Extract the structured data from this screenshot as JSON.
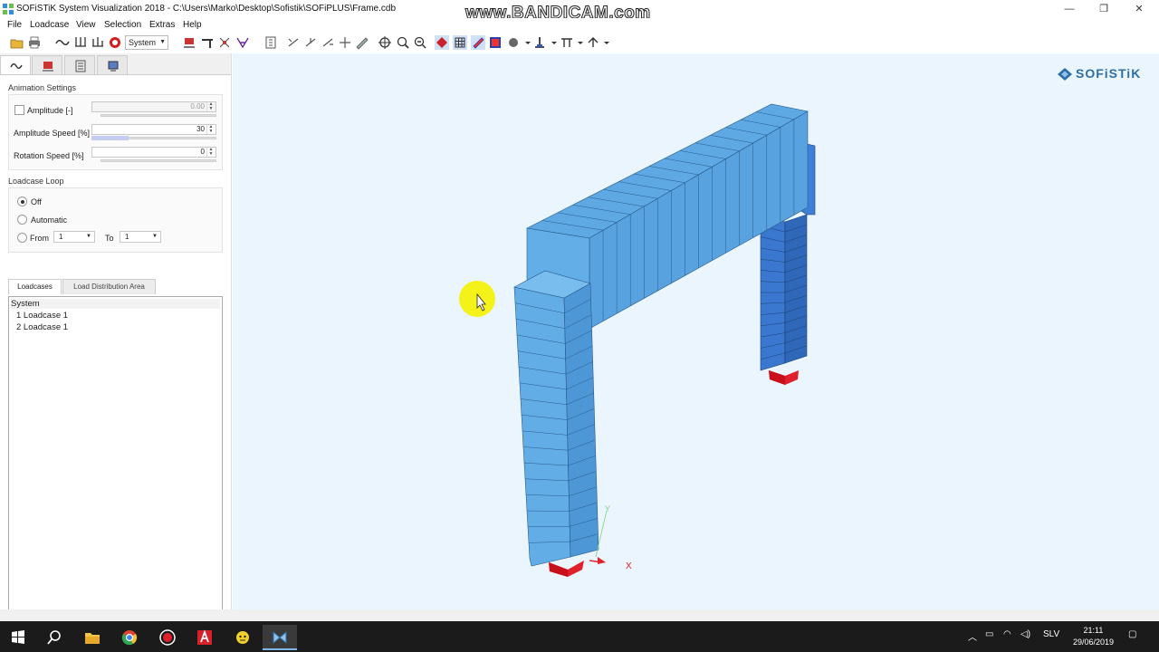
{
  "window": {
    "title": "SOFiSTiK System Visualization 2018 - C:\\Users\\Marko\\Desktop\\Sofistik\\SOFiPLUS\\Frame.cdb",
    "watermark": "www.BANDICAM.com",
    "minimize": "—",
    "restore": "❐",
    "close": "✕"
  },
  "menu": {
    "file": "File",
    "loadcase": "Loadcase",
    "view": "View",
    "selection": "Selection",
    "extras": "Extras",
    "help": "Help"
  },
  "toolbar": {
    "system_select": "System"
  },
  "panel": {
    "animation_settings": "Animation Settings",
    "amplitude_label": "Amplitude [-]",
    "amplitude_value": "0.00",
    "amplitude_speed_label": "Amplitude Speed [%]",
    "amplitude_speed_value": "30",
    "amplitude_speed_level": 0.3,
    "rotation_speed_label": "Rotation Speed [%]",
    "rotation_speed_value": "0",
    "loadcase_loop": "Loadcase Loop",
    "off": "Off",
    "automatic": "Automatic",
    "from": "From",
    "from_value": "1",
    "to": "To",
    "to_value": "1",
    "tab_loadcases": "Loadcases",
    "tab_load_distribution": "Load Distribution Area",
    "tree_root": "System",
    "tree_items": [
      "1 Loadcase 1",
      "2 Loadcase 1"
    ]
  },
  "viewport": {
    "brand": "SOFiSTiK",
    "axis_x": "X",
    "axis_y": "Y",
    "colors": {
      "beam": "#5aa9e3",
      "column_right": "#3f7fd6",
      "support": "#e8202a",
      "background": "#eaf5fd"
    }
  },
  "taskbar": {
    "language": "SLV",
    "time": "21:11",
    "date": "29/06/2019"
  }
}
